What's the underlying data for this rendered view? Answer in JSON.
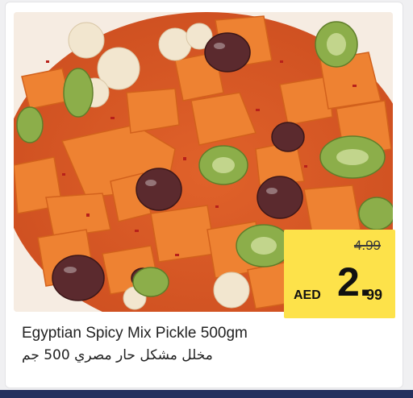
{
  "product": {
    "name_en": "Egyptian Spicy Mix Pickle 500gm",
    "name_ar": "مخلل مشكل حار مصري 500 جم",
    "image_alt": "Spicy mixed pickle with carrots, olives, cucumber and cauliflower"
  },
  "price": {
    "old": "4.99",
    "currency": "AED",
    "integer": "2.",
    "decimals": "99"
  },
  "colors": {
    "price_box": "#fde24a",
    "footer_bar": "#24305e",
    "carrot": "#e8742a",
    "olive": "#5b2a2e",
    "cucumber": "#8cae4a"
  }
}
